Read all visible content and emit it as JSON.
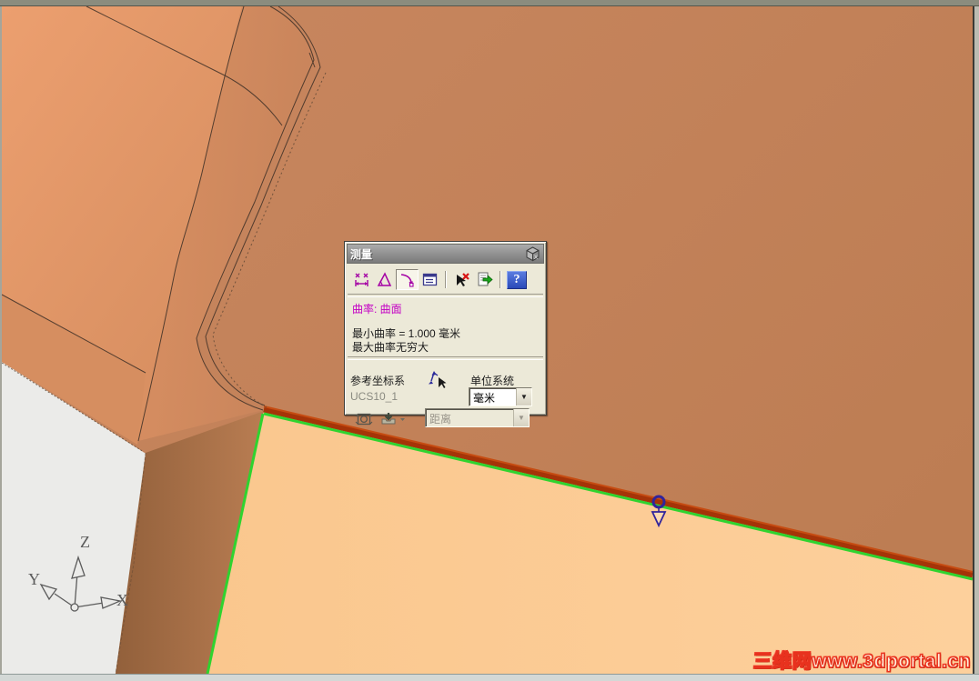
{
  "viewport": {
    "watermark": "三维网www.3dportal.cn",
    "axis_triad": {
      "x": "X",
      "y": "Y",
      "z": "Z"
    },
    "colors": {
      "background": "#ebebe9",
      "main_face": "#c2815a",
      "light_face": "#ea9e6e",
      "bottom_face": "#fbca92",
      "side_strip": "#9a673f",
      "highlight_edge_green": "#2fd32f",
      "highlight_edge_maroon": "#a53408",
      "marker_blue": "#31249b"
    }
  },
  "measure_dialog": {
    "title": "测量",
    "toolbar_icons": [
      "distance-measure",
      "angle-measure",
      "curvature-measure",
      "measurement-info",
      "clear-selection",
      "export-results",
      "help"
    ],
    "selected_tool": "curvature-measure",
    "help_glyph": "?",
    "result": {
      "mode_line": "曲率:  曲面",
      "min_line": "最小曲率 = 1.000 毫米",
      "max_line": "最大曲率无穷大"
    },
    "reference_csys_label": "参考坐标系",
    "reference_csys_value": "UCS10_1",
    "unit_system_label": "单位系统",
    "unit_value": "毫米",
    "unit_dropdown_glyph": "▼",
    "distance_field_value": "距离",
    "distance_dropdown_glyph": "▼"
  }
}
